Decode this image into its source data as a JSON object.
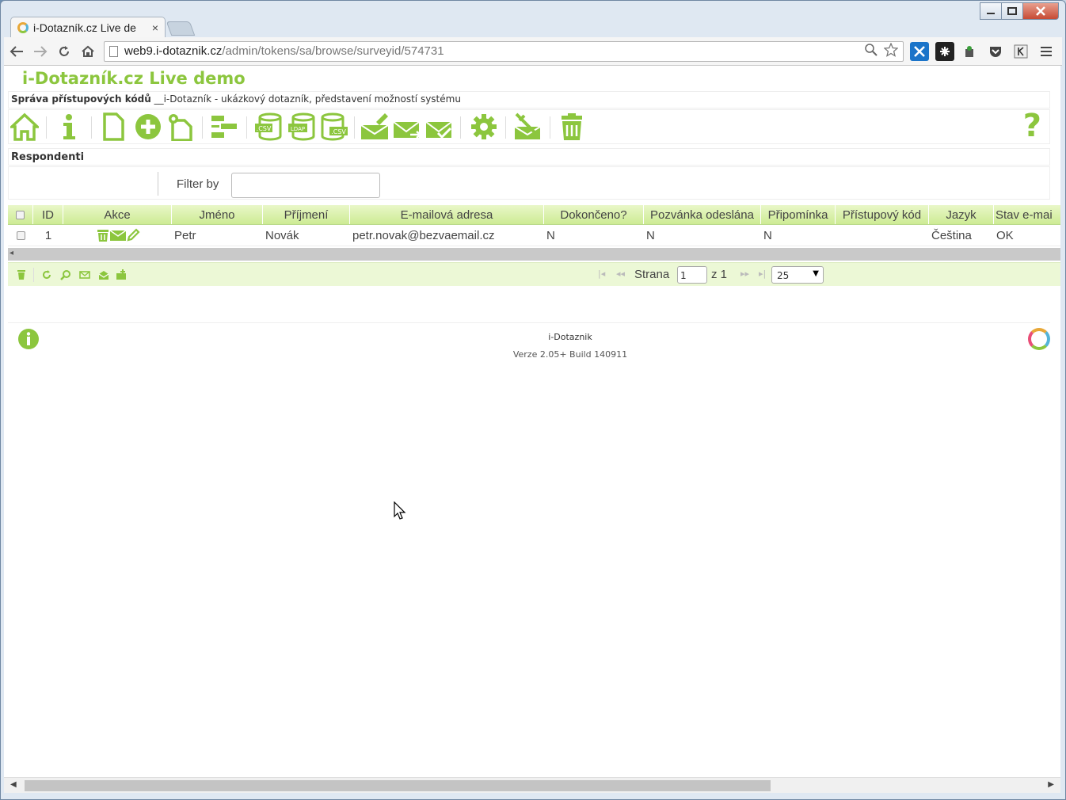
{
  "browser": {
    "tab_title": "i-Dotazník.cz Live de",
    "tab_close": "×",
    "url_host": "web9.i-dotaznik.cz",
    "url_path": "/admin/tokens/sa/browse/surveyid/574731",
    "window_buttons": [
      "minimize",
      "maximize",
      "close"
    ]
  },
  "site": {
    "title": "i-Dotazník.cz Live demo",
    "breadcrumb_bold": "Správa přístupových kódů",
    "breadcrumb_rest": " __i-Dotazník - ukázkový dotazník, představení možností systému"
  },
  "icons": {
    "toolbar": [
      "home-icon",
      "info-icon",
      "new-document-icon",
      "add-icon",
      "generate-tokens-icon",
      "manage-attributes-icon",
      "import-csv-icon",
      "import-ldap-icon",
      "export-csv-icon",
      "edit-email-icon",
      "send-invitations-icon",
      "send-reminders-icon",
      "settings-icon",
      "bounce-settings-icon",
      "delete-table-icon",
      "help-icon"
    ]
  },
  "section": {
    "title": "Respondenti",
    "filter_label": "Filter by",
    "filter_value": ""
  },
  "grid": {
    "columns": [
      "ID",
      "Akce",
      "Jméno",
      "Příjmení",
      "E-mailová adresa",
      "Dokončeno?",
      "Pozvánka odeslána",
      "Připomínka",
      "Přístupový kód",
      "Jazyk",
      "Stav e-mai"
    ],
    "rows": [
      {
        "id": "1",
        "jmeno": "Petr",
        "prijmeni": "Novák",
        "email": "petr.novak@bezvaemail.cz",
        "dokonceno": "N",
        "pozvanka": "N",
        "pripominka": "N",
        "kod": "",
        "jazyk": "Čeština",
        "stav": "OK"
      }
    ]
  },
  "pager": {
    "page_label": "Strana",
    "page_value": "1",
    "of_label": "z 1",
    "rows_per_page": "25"
  },
  "footer": {
    "name": "i-Dotaznik",
    "version": "Verze 2.05+ Build 140911"
  },
  "colors": {
    "brand_green": "#8cc63e",
    "header_green": "#cdeb94",
    "pager_bg": "#ecf8d6"
  }
}
